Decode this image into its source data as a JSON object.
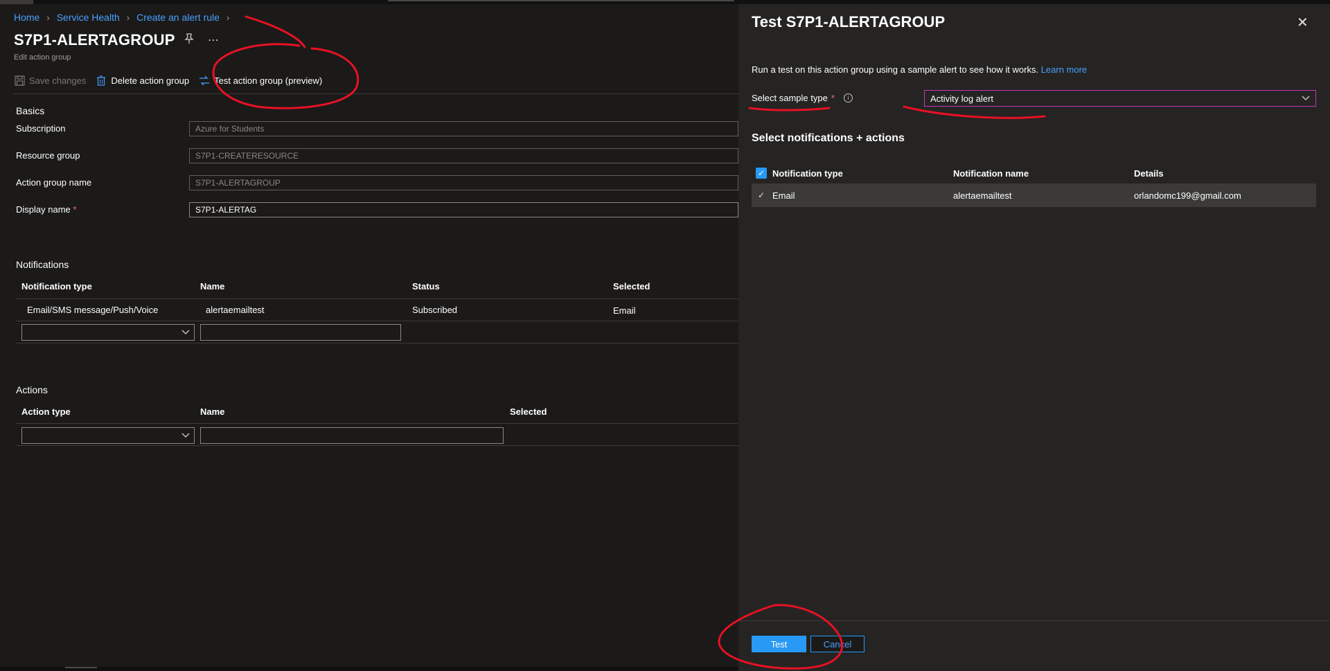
{
  "breadcrumb": {
    "home": "Home",
    "service_health": "Service Health",
    "create_alert_rule": "Create an alert rule"
  },
  "page": {
    "title": "S7P1-ALERTAGROUP",
    "subtitle": "Edit action group"
  },
  "toolbar": {
    "save_label": "Save changes",
    "delete_label": "Delete action group",
    "test_label": "Test action group (preview)"
  },
  "basics": {
    "heading": "Basics",
    "subscription_label": "Subscription",
    "subscription_value": "Azure for Students",
    "resource_group_label": "Resource group",
    "resource_group_value": "S7P1-CREATERESOURCE",
    "action_group_name_label": "Action group name",
    "action_group_name_value": "S7P1-ALERTAGROUP",
    "display_name_label": "Display name",
    "display_name_value": "S7P1-ALERTAG"
  },
  "notifications": {
    "heading": "Notifications",
    "columns": [
      "Notification type",
      "Name",
      "Status",
      "Selected"
    ],
    "row": {
      "type": "Email/SMS message/Push/Voice",
      "name": "alertaemailtest",
      "status": "Subscribed",
      "selected": "Email"
    }
  },
  "actions": {
    "heading": "Actions",
    "columns": [
      "Action type",
      "Name",
      "Selected"
    ]
  },
  "panel": {
    "title": "Test S7P1-ALERTAGROUP",
    "description": "Run a test on this action group using a sample alert to see how it works.",
    "learn_more": "Learn more",
    "sample_type_label": "Select sample type",
    "sample_type_value": "Activity log alert",
    "subheading": "Select notifications + actions",
    "columns": [
      "Notification type",
      "Notification name",
      "Details"
    ],
    "row": {
      "type": "Email",
      "name": "alertaemailtest",
      "details": "orlandomc199@gmail.com"
    },
    "test_button": "Test",
    "cancel_button": "Cancel"
  },
  "colors": {
    "accent": "#2899f5",
    "link": "#4aa0ff",
    "annotation": "#e81123",
    "background": "#1b1a19",
    "panel": "#252423"
  }
}
